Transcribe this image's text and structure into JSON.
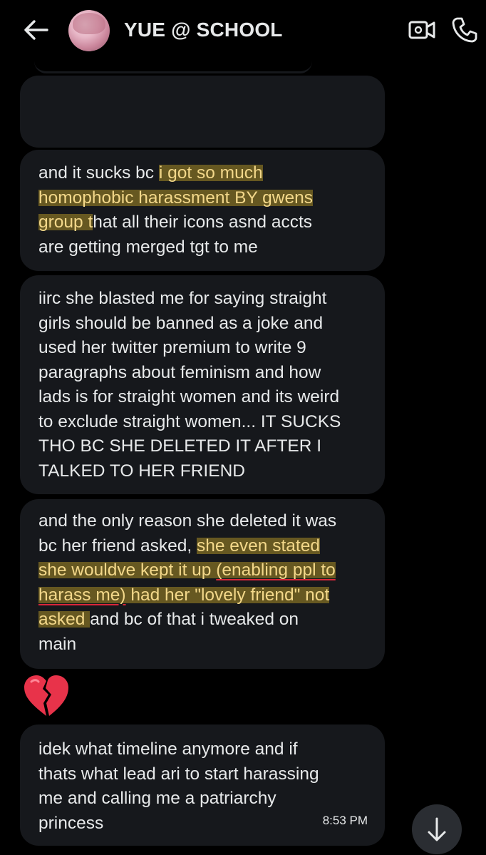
{
  "header": {
    "title": "YUE @ SCHOOL",
    "back_icon": "arrow-left-icon",
    "video_icon": "video-camera-icon",
    "call_icon": "phone-icon"
  },
  "messages": [
    {
      "id": "blank",
      "lines": []
    },
    {
      "id": "m1",
      "lines": [
        [
          {
            "t": "and it sucks bc "
          },
          {
            "t": "i got so much",
            "hl": true
          }
        ],
        [
          {
            "t": "homophobic harassment BY gwens",
            "hl": true
          }
        ],
        [
          {
            "t": "group t",
            "hl": true
          },
          {
            "t": "hat all their icons asnd accts"
          }
        ],
        [
          {
            "t": "are getting merged tgt to me"
          }
        ]
      ]
    },
    {
      "id": "m2",
      "lines": [
        [
          {
            "t": "iirc she blasted me for saying straight"
          }
        ],
        [
          {
            "t": "girls should be banned as a joke and"
          }
        ],
        [
          {
            "t": "used her twitter premium to write 9"
          }
        ],
        [
          {
            "t": "paragraphs about feminism and how"
          }
        ],
        [
          {
            "t": "lads is for straight women and its weird"
          }
        ],
        [
          {
            "t": "to exclude straight women... IT SUCKS"
          }
        ],
        [
          {
            "t": "THO BC SHE DELETED IT AFTER I"
          }
        ],
        [
          {
            "t": "TALKED TO HER FRIEND"
          }
        ]
      ]
    },
    {
      "id": "m3",
      "lines": [
        [
          {
            "t": "and the only reason she deleted it was"
          }
        ],
        [
          {
            "t": "bc her friend asked, "
          },
          {
            "t": "she even stated",
            "hl": true
          }
        ],
        [
          {
            "t": "she wouldve kept it up ",
            "hl": true
          },
          {
            "t": "(enabling ppl to",
            "hl": true,
            "ul": true
          }
        ],
        [
          {
            "t": "harass me)",
            "hl": true,
            "ul": true
          },
          {
            "t": " had her \"lovely friend\" not",
            "hl": true
          }
        ],
        [
          {
            "t": "asked ",
            "hl": true
          },
          {
            "t": "and bc of that i tweaked on"
          }
        ],
        [
          {
            "t": "main"
          }
        ]
      ]
    },
    {
      "id": "m4",
      "lines": [
        [
          {
            "t": "idek what timeline anymore and if"
          }
        ],
        [
          {
            "t": "thats what lead ari to start harassing"
          }
        ],
        [
          {
            "t": "me and calling me a patriarchy"
          }
        ],
        [
          {
            "t": "princess"
          }
        ]
      ],
      "time": "8:53 PM"
    }
  ],
  "reaction": {
    "emoji": "broken-heart-icon"
  },
  "scroll_button": {
    "icon": "arrow-down-icon"
  },
  "colors": {
    "background": "#000000",
    "bubble": "#16181c",
    "text": "#e7e9ea",
    "highlight": "#d6b028",
    "underline": "#d9263a"
  }
}
